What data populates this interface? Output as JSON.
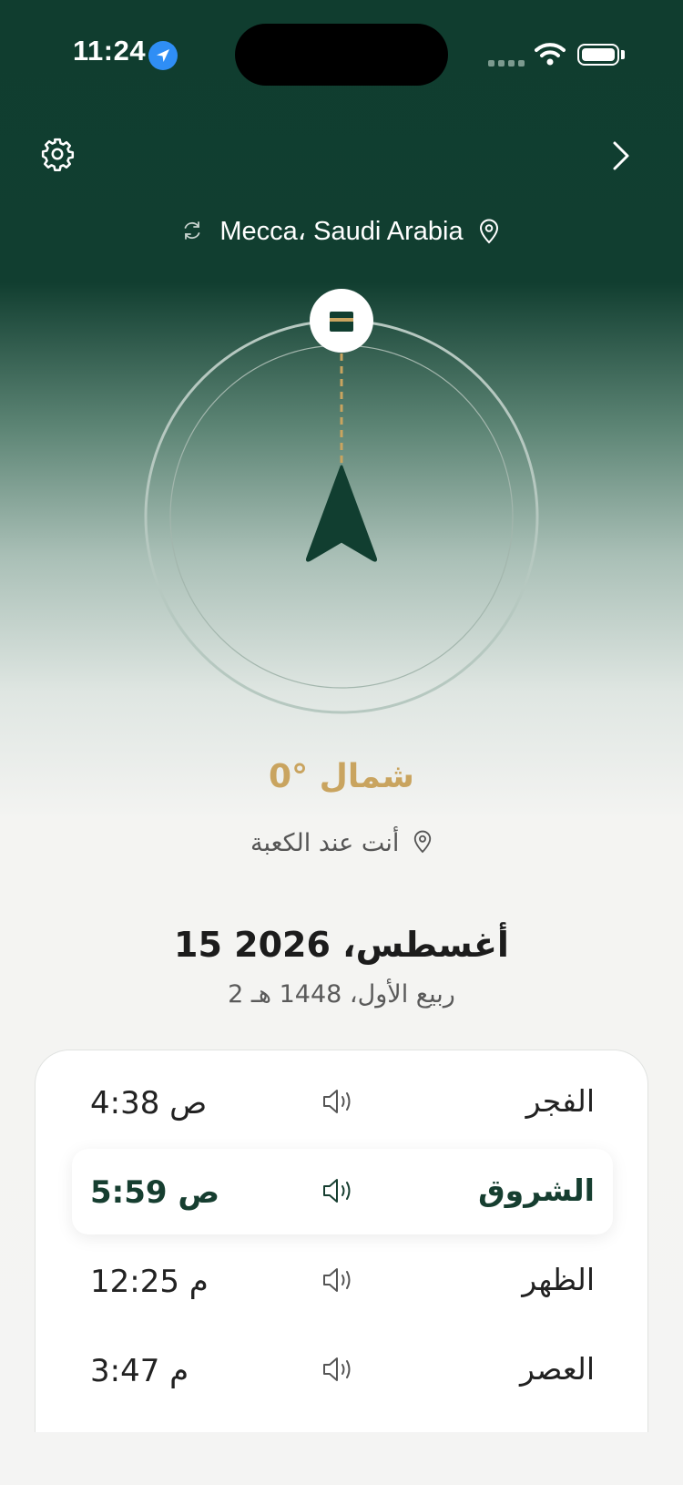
{
  "status_bar": {
    "time": "11:24"
  },
  "header": {
    "location": "Mecca، Saudi Arabia",
    "icons": [
      "settings-gear-icon",
      "chevron-right-icon",
      "refresh-icon",
      "location-pin-icon"
    ]
  },
  "compass": {
    "heading_text": "0° شمال",
    "heading_degrees": 0,
    "note": "أنت عند الكعبة",
    "icons": [
      "kaaba-icon",
      "direction-arrow-icon"
    ]
  },
  "date": {
    "gregorian": "15 أغسطس، 2026",
    "hijri": "2 ربيع الأول، 1448 هـ"
  },
  "prayers": [
    {
      "name": "الفجر",
      "time": "4:38 ص",
      "highlighted": false
    },
    {
      "name": "الشروق",
      "time": "5:59 ص",
      "highlighted": true
    },
    {
      "name": "الظهر",
      "time": "12:25 م",
      "highlighted": false
    },
    {
      "name": "العصر",
      "time": "3:47 م",
      "highlighted": false
    }
  ],
  "colors": {
    "primary_green": "#113e30",
    "gold": "#c9a45f",
    "status_blue": "#2f8ef5"
  }
}
